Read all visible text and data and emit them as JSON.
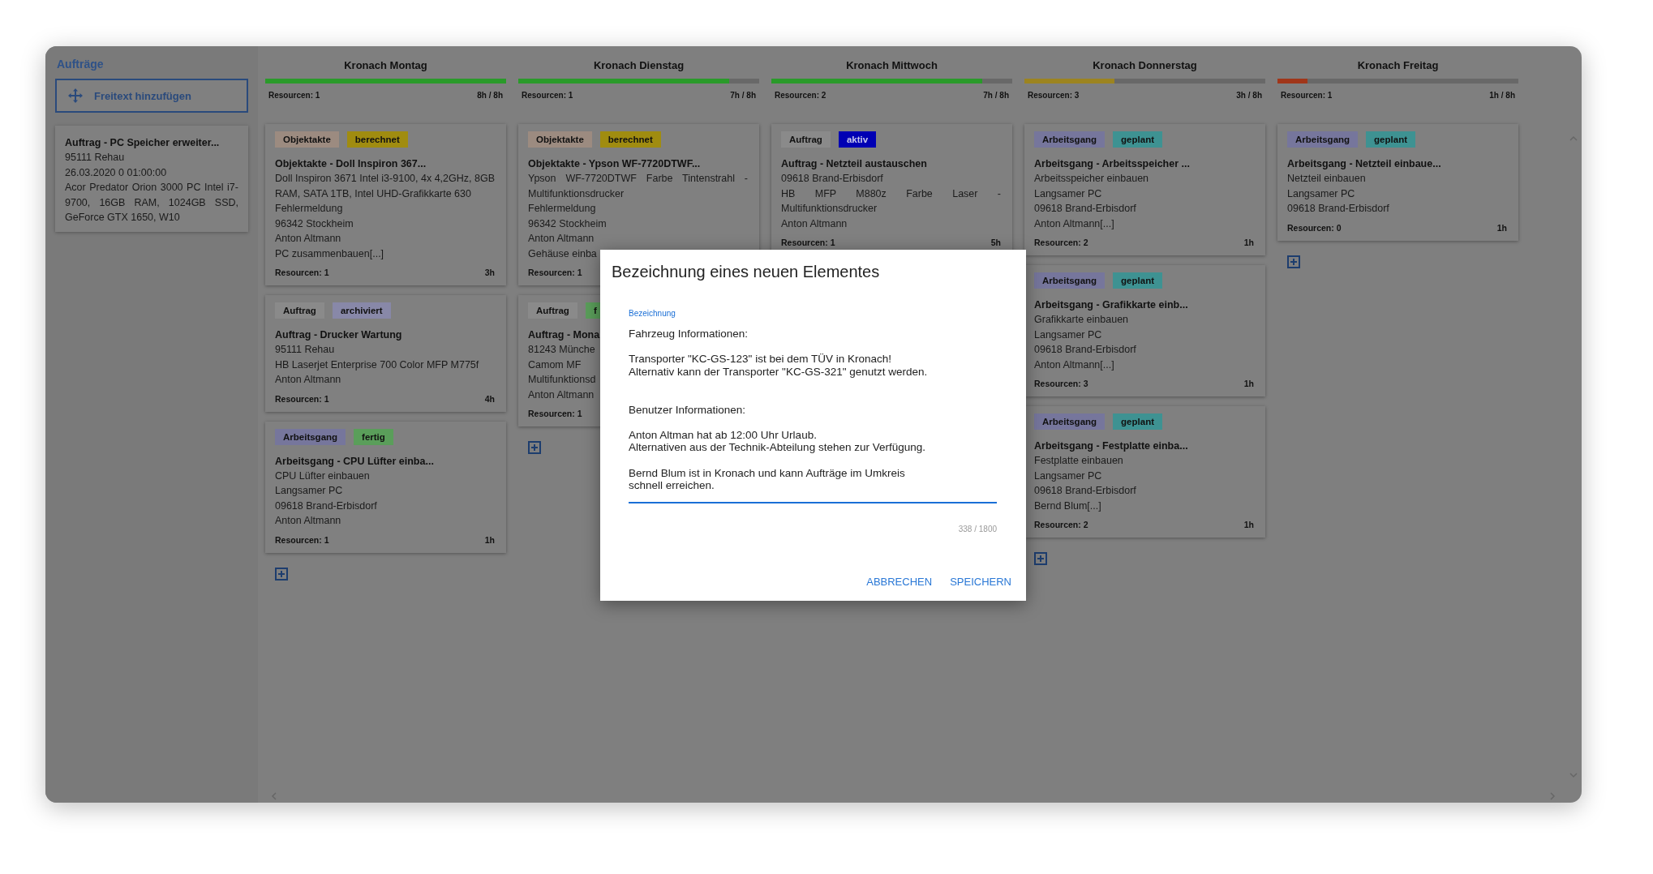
{
  "sidebar": {
    "title": "Aufträge",
    "add_button": "Freitext hinzufügen",
    "cards": [
      {
        "title": "Auftrag - PC Speicher erweiter...",
        "lines": [
          "95111 Rehau",
          "26.03.2020 0 01:00:00",
          "Acor Predator Orion 3000 PC Intel i7-9700, 16GB RAM, 1024GB SSD, GeForce GTX 1650, W10"
        ]
      }
    ]
  },
  "columns": [
    {
      "title": "Kronach Montag",
      "level": 1,
      "color": "#2a9a2a",
      "resources": "Resourcen: 1",
      "hours": "8h / 8h",
      "add_button": true,
      "cards": [
        {
          "tags": [
            {
              "label": "Objektakte",
              "color": "#9c8b80"
            },
            {
              "label": "berechnet",
              "color": "#a08c10"
            }
          ],
          "title": "Objektakte - Doll Inspiron 367...",
          "lines": [
            "Doll Inspiron 3671 Intel i3-9100, 4x 4,2GHz, 8GB RAM, SATA 1TB, Intel UHD-Grafikkarte 630",
            "Fehlermeldung",
            "96342 Stockheim",
            "Anton Altmann",
            "PC zusammenbauen[...]"
          ],
          "resources": "Resourcen: 1",
          "hours": "3h"
        },
        {
          "tags": [
            {
              "label": "Auftrag",
              "color": "#8a8a8a"
            },
            {
              "label": "archiviert",
              "color": "#8888a8"
            }
          ],
          "title": "Auftrag - Drucker Wartung",
          "lines": [
            "95111 Rehau",
            "HB Laserjet Enterprise 700 Color MFP M775f",
            "Anton Altmann"
          ],
          "resources": "Resourcen: 1",
          "hours": "4h"
        },
        {
          "tags": [
            {
              "label": "Arbeitsgang",
              "color": "#76769c"
            },
            {
              "label": "fertig",
              "color": "#5a9e5a"
            }
          ],
          "title": "Arbeitsgang - CPU Lüfter einba...",
          "lines": [
            "CPU Lüfter einbauen",
            "Langsamer PC",
            "09618 Brand-Erbisdorf",
            "Anton Altmann"
          ],
          "resources": "Resourcen: 1",
          "hours": "1h"
        }
      ]
    },
    {
      "title": "Kronach Dienstag",
      "level": 0.875,
      "color": "#2a9a2a",
      "resources": "Resourcen: 1",
      "hours": "7h / 8h",
      "add_button": true,
      "cards": [
        {
          "tags": [
            {
              "label": "Objektakte",
              "color": "#9c8b80"
            },
            {
              "label": "berechnet",
              "color": "#a08c10"
            }
          ],
          "title": "Objektakte - Ypson WF-7720DTWF...",
          "lines": [
            "Ypson WF-7720DTWF Farbe Tintenstrahl - Multifunktionsdrucker",
            "Fehlermeldung",
            "96342 Stockheim",
            "Anton Altmann",
            "Gehäuse einba"
          ],
          "resources": "Resourcen: 1"
        },
        {
          "tags": [
            {
              "label": "Auftrag",
              "color": "#8a8a8a"
            },
            {
              "label": "f",
              "color": "#5a9e5a"
            }
          ],
          "title": "Auftrag - Mona",
          "lines": [
            "81243 Münche",
            "Camom MF",
            "Multifunktionsd",
            "Anton Altmann"
          ],
          "resources": "Resourcen: 1"
        }
      ]
    },
    {
      "title": "Kronach Mittwoch",
      "level": 0.875,
      "color": "#2a9a2a",
      "resources": "Resourcen: 2",
      "hours": "7h / 8h",
      "add_button": false,
      "cards": [
        {
          "tags": [
            {
              "label": "Auftrag",
              "color": "#8a8a8a"
            },
            {
              "label": "aktiv",
              "color": "#0000b4"
            }
          ],
          "title": "Auftrag - Netzteil austauschen",
          "lines": [
            "09618 Brand-Erbisdorf",
            "HB MFP M880z Farbe Laser - Multifunktionsdrucker",
            "Anton Altmann"
          ],
          "resources": "Resourcen: 1",
          "hours": "5h"
        }
      ]
    },
    {
      "title": "Kronach Donnerstag",
      "level": 0.375,
      "color": "#9c8420",
      "resources": "Resourcen: 3",
      "hours": "3h / 8h",
      "add_button": true,
      "cards": [
        {
          "tags": [
            {
              "label": "Arbeitsgang",
              "color": "#76769c"
            },
            {
              "label": "geplant",
              "color": "#3e9292"
            }
          ],
          "title": "Arbeitsgang - Arbeitsspeicher ...",
          "lines": [
            "Arbeitsspeicher einbauen",
            "Langsamer PC",
            "09618 Brand-Erbisdorf",
            "Anton Altmann[...]"
          ],
          "resources": "Resourcen: 2",
          "hours": "1h"
        },
        {
          "tags": [
            {
              "label": "Arbeitsgang",
              "color": "#76769c"
            },
            {
              "label": "geplant",
              "color": "#3e9292"
            }
          ],
          "title": "Arbeitsgang - Grafikkarte einb...",
          "lines": [
            "Grafikkarte einbauen",
            "Langsamer PC",
            "09618 Brand-Erbisdorf",
            "Anton Altmann[...]"
          ],
          "resources": "Resourcen: 3",
          "hours": "1h"
        },
        {
          "tags": [
            {
              "label": "Arbeitsgang",
              "color": "#76769c"
            },
            {
              "label": "geplant",
              "color": "#3e9292"
            }
          ],
          "title": "Arbeitsgang - Festplatte einba...",
          "lines": [
            "Festplatte einbauen",
            "Langsamer PC",
            "09618 Brand-Erbisdorf",
            "Bernd Blum[...]"
          ],
          "resources": "Resourcen: 2",
          "hours": "1h"
        }
      ]
    },
    {
      "title": "Kronach Freitag",
      "level": 0.125,
      "color": "#a0361a",
      "resources": "Resourcen: 1",
      "hours": "1h / 8h",
      "add_button": true,
      "cards": [
        {
          "tags": [
            {
              "label": "Arbeitsgang",
              "color": "#76769c"
            },
            {
              "label": "geplant",
              "color": "#3e9292"
            }
          ],
          "title": "Arbeitsgang - Netzteil einbaue...",
          "lines": [
            "Netzteil einbauen",
            "Langsamer PC",
            "09618 Brand-Erbisdorf"
          ],
          "resources": "Resourcen: 0",
          "hours": "1h"
        }
      ]
    }
  ],
  "dialog": {
    "title": "Bezeichnung eines neuen Elementes",
    "field_label": "Bezeichnung",
    "value": "Fahrzeug Informationen:\n\nTransporter \"KC-GS-123\" ist bei dem TÜV in Kronach!\nAlternativ kann der Transporter \"KC-GS-321\" genutzt werden.\n\n\nBenutzer Informationen:\n\nAnton Altman hat ab 12:00 Uhr Urlaub.\nAlternativen aus der Technik-Abteilung stehen zur Verfügung.\n\nBernd Blum ist in Kronach und kann Aufträge im Umkreis\nschnell erreichen.",
    "counter": "338 / 1800",
    "buttons": [
      "ABBRECHEN",
      "SPEICHERN"
    ]
  }
}
